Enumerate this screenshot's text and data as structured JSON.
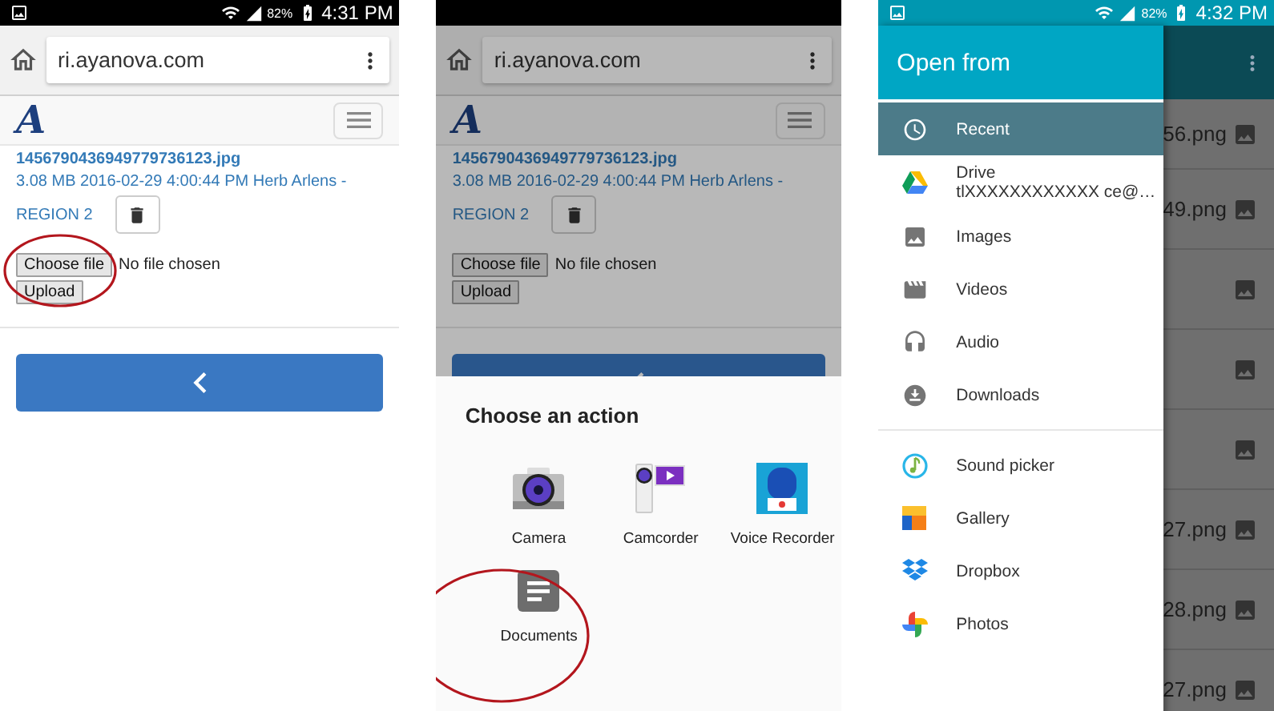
{
  "browser_screen": {
    "status_bar": {
      "battery": "82%",
      "time": "4:31 PM"
    },
    "browser": {
      "url": "ri.ayanova.com"
    },
    "page": {
      "logo": "A",
      "file_name": "1456790436949779736123.jpg",
      "file_info": "3.08 MB 2016-02-29 4:00:44 PM Herb Arlens -",
      "region": "REGION 2",
      "choose_file": "Choose file",
      "file_status": "No file chosen",
      "upload": "Upload"
    }
  },
  "chooser_screen": {
    "browser": {
      "url": "ri.ayanova.com"
    },
    "page": {
      "logo": "A",
      "file_name": "1456790436949779736123.jpg",
      "file_info": "3.08 MB 2016-02-29 4:00:44 PM Herb Arlens -",
      "region": "REGION 2",
      "choose_file": "Choose file",
      "file_status": "No file chosen",
      "upload": "Upload"
    },
    "sheet": {
      "title": "Choose an action",
      "apps": [
        {
          "kind": "camera",
          "label": "Camera"
        },
        {
          "kind": "camcorder",
          "label": "Camcorder"
        },
        {
          "kind": "recorder",
          "label": "Voice Recorder"
        },
        {
          "kind": "documents",
          "label": "Documents"
        }
      ]
    }
  },
  "picker_screen": {
    "status_bar": {
      "battery": "82%",
      "time": "4:32 PM"
    },
    "drawer": {
      "title": "Open from",
      "sections": [
        {
          "items": [
            {
              "kind": "clock",
              "label": "Recent",
              "selected": true
            },
            {
              "kind": "drive",
              "label": "Drive",
              "detail": "tlXXXXXXXXXXXX ce@…",
              "selected": false
            },
            {
              "kind": "images",
              "label": "Images",
              "selected": false
            },
            {
              "kind": "videos",
              "label": "Videos",
              "selected": false
            },
            {
              "kind": "audio",
              "label": "Audio",
              "selected": false
            },
            {
              "kind": "downloads",
              "label": "Downloads",
              "selected": false
            }
          ]
        },
        {
          "items": [
            {
              "kind": "sound",
              "label": "Sound picker",
              "selected": false
            },
            {
              "kind": "gallery",
              "label": "Gallery",
              "selected": false
            },
            {
              "kind": "dropbox",
              "label": "Dropbox",
              "selected": false
            },
            {
              "kind": "photos",
              "label": "Photos",
              "selected": false
            }
          ]
        }
      ]
    },
    "files": [
      {
        "kind": "named",
        "name": "56.png"
      },
      {
        "kind": "named",
        "name": "49.png"
      },
      {
        "kind": "unnamed"
      },
      {
        "kind": "unnamed"
      },
      {
        "kind": "unnamed"
      },
      {
        "kind": "named",
        "name": "27.png"
      },
      {
        "kind": "named",
        "name": "28.png"
      },
      {
        "kind": "named",
        "name": "27.png"
      }
    ]
  }
}
